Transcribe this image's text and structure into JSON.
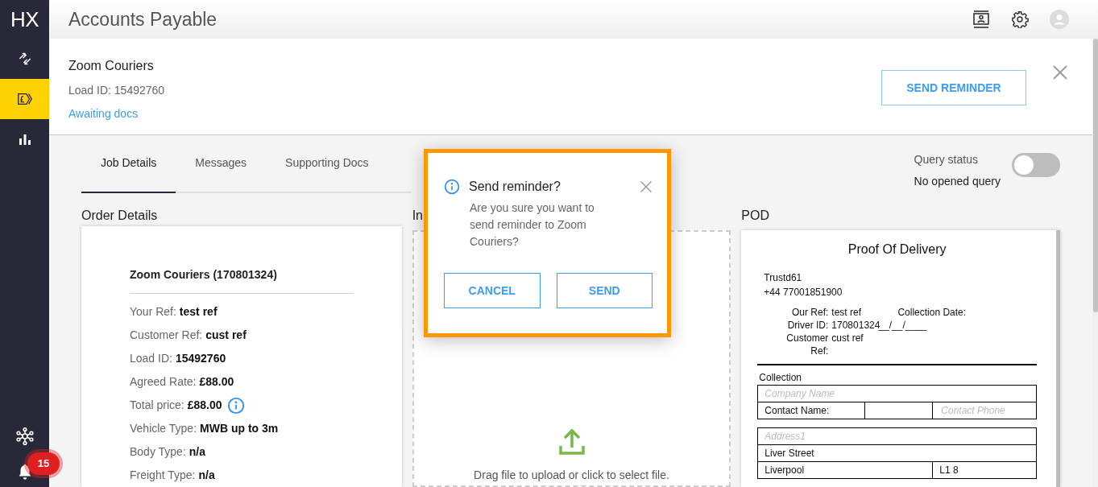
{
  "app": {
    "logo": "HX",
    "title": "Accounts Payable"
  },
  "sidebar": {
    "items": [
      {
        "kind": "arrows",
        "selected": false
      },
      {
        "kind": "pound",
        "selected": true
      },
      {
        "kind": "chart",
        "selected": false
      }
    ],
    "notification_count": "15"
  },
  "job_header": {
    "company": "Zoom Couriers",
    "load_id": "Load ID: 15492760",
    "status": "Awaiting docs",
    "action_button": "SEND REMINDER"
  },
  "tabs": [
    {
      "label": "Job Details",
      "selected": true
    },
    {
      "label": "Messages",
      "selected": false
    },
    {
      "label": "Supporting Docs",
      "selected": false
    }
  ],
  "query_status": {
    "label": "Query status",
    "value": "No opened query",
    "on": false
  },
  "order_details": {
    "heading": "Order Details",
    "title": "Zoom Couriers (170801324)",
    "fields": [
      {
        "label": "Your Ref:",
        "value": "test ref",
        "info": false
      },
      {
        "label": "Customer Ref:",
        "value": "cust ref",
        "info": false
      },
      {
        "label": "Load ID:",
        "value": "15492760",
        "info": false
      },
      {
        "label": "Agreed Rate:",
        "value": "£88.00",
        "info": false
      },
      {
        "label": "Total price:",
        "value": "£88.00",
        "info": true
      },
      {
        "label": "Vehicle Type:",
        "value": "MWB up to 3m",
        "info": false
      },
      {
        "label": "Body Type:",
        "value": "n/a",
        "info": false
      },
      {
        "label": "Freight Type:",
        "value": "n/a",
        "info": false
      }
    ]
  },
  "invoice": {
    "heading": "In",
    "upload_hint": "Drag file to upload or click to select file."
  },
  "pod": {
    "heading": "POD",
    "document": {
      "title": "Proof Of Delivery",
      "sender": "Trustd61",
      "phone": "+44 77001851900",
      "refs": [
        {
          "label": "Our Ref:",
          "value": "test ref"
        },
        {
          "label": "Driver ID:",
          "value": "170801324"
        },
        {
          "label": "Customer Ref:",
          "value": "cust ref"
        }
      ],
      "collection_date_label": "Collection Date:",
      "collection_date_blank": "__/__/____",
      "collection_heading": "Collection",
      "company_placeholder": "Company Name",
      "contact_name_label": "Contact Name:",
      "contact_phone_placeholder": "Contact Phone",
      "address_placeholder": "Address1",
      "street": "Liver Street",
      "city": "Liverpool",
      "postcode": "L1 8"
    }
  },
  "dialog": {
    "title": "Send reminder?",
    "message": "Are you sure you want to send reminder to Zoom Couriers?",
    "buttons": [
      "CANCEL",
      "SEND"
    ]
  }
}
